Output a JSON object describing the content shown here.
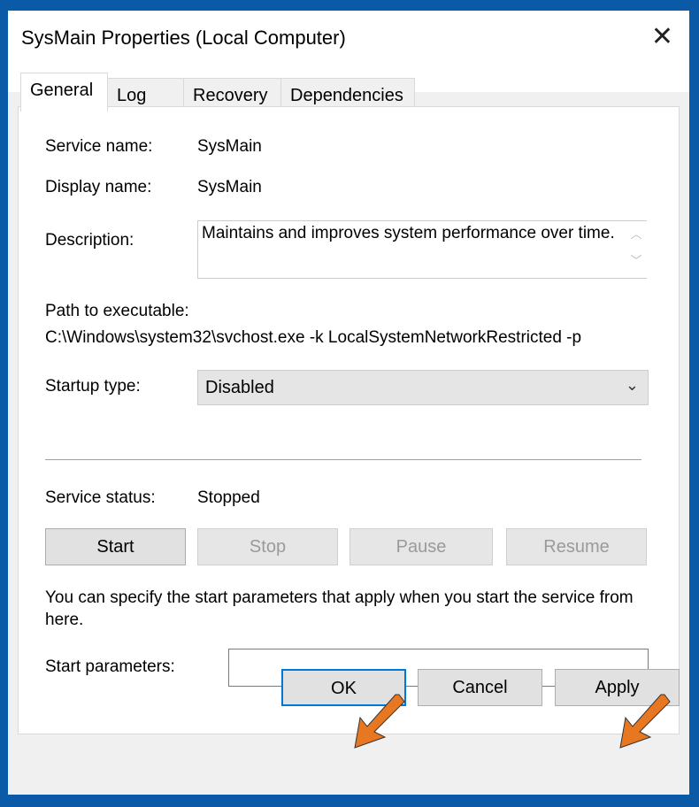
{
  "window": {
    "title": "SysMain Properties (Local Computer)",
    "close_icon": "close-icon"
  },
  "tabs": [
    {
      "label": "General",
      "active": true
    },
    {
      "label": "Log On"
    },
    {
      "label": "Recovery"
    },
    {
      "label": "Dependencies"
    }
  ],
  "general": {
    "service_name_label": "Service name:",
    "service_name": "SysMain",
    "display_name_label": "Display name:",
    "display_name": "SysMain",
    "description_label": "Description:",
    "description": "Maintains and improves system performance over time.",
    "path_label": "Path to executable:",
    "path": "C:\\Windows\\system32\\svchost.exe -k LocalSystemNetworkRestricted -p",
    "startup_type_label": "Startup type:",
    "startup_type": "Disabled",
    "service_status_label": "Service status:",
    "service_status": "Stopped",
    "buttons": {
      "start": "Start",
      "stop": "Stop",
      "pause": "Pause",
      "resume": "Resume"
    },
    "help_text": "You can specify the start parameters that apply when you start the service from here.",
    "start_parameters_label": "Start parameters:",
    "start_parameters": ""
  },
  "footer": {
    "ok": "OK",
    "cancel": "Cancel",
    "apply": "Apply"
  },
  "colors": {
    "annotation_arrow": "#e87722",
    "focus_border": "#0078d7",
    "desktop": "#0a5aa8"
  }
}
